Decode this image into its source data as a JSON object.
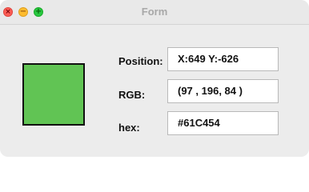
{
  "window": {
    "title": "Form",
    "controls": {
      "close_glyph": "×",
      "minimize_glyph": "−",
      "zoom_glyph": "+"
    }
  },
  "color_swatch": {
    "color": "#61C454"
  },
  "form": {
    "position_label": "Position:",
    "position_value": "X:649  Y:-626",
    "rgb_label": "RGB:",
    "rgb_value": "(97 , 196, 84 )",
    "hex_label": "hex:",
    "hex_value": "#61C454"
  }
}
